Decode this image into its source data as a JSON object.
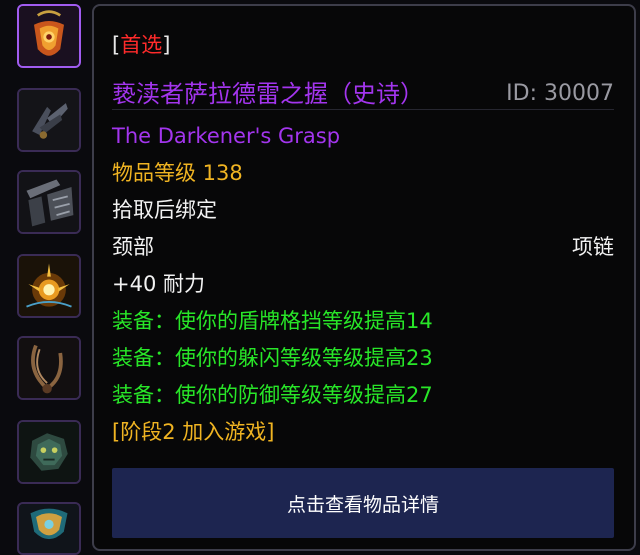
{
  "icon_slots": [
    {
      "icon": "amulet-orange-icon",
      "selected": true
    },
    {
      "icon": "winged-pendant-icon",
      "selected": false
    },
    {
      "icon": "weapon-bundle-icon",
      "selected": false
    },
    {
      "icon": "golden-burst-icon",
      "selected": false
    },
    {
      "icon": "rope-necklace-icon",
      "selected": false
    },
    {
      "icon": "dragon-pendant-icon",
      "selected": false
    },
    {
      "icon": "teal-gold-amulet-icon",
      "selected": false
    }
  ],
  "tooltip": {
    "bracket_open": "[",
    "first_pick_label": "首选",
    "bracket_close": "]",
    "item_name": "亵渎者萨拉德雷之握（史诗）",
    "item_id": "ID: 30007",
    "english_name": "The Darkener's Grasp",
    "item_level": "物品等级 138",
    "binding": "拾取后绑定",
    "slot": "颈部",
    "item_type": "项链",
    "stat": "+40 耐力",
    "equip_effects": [
      "装备：使你的盾牌格挡等级提高14",
      "装备：使你的躲闪等级等级提高23",
      "装备：使你的防御等级等级提高27"
    ],
    "phase": "[阶段2 加入游戏]",
    "details_button": "点击查看物品详情"
  },
  "colors": {
    "epic": "#a335ee",
    "item_level": "#f0b422",
    "equip_green": "#28e628",
    "first_pick_red": "#ff2b2b",
    "button_bg": "#1d2550"
  }
}
